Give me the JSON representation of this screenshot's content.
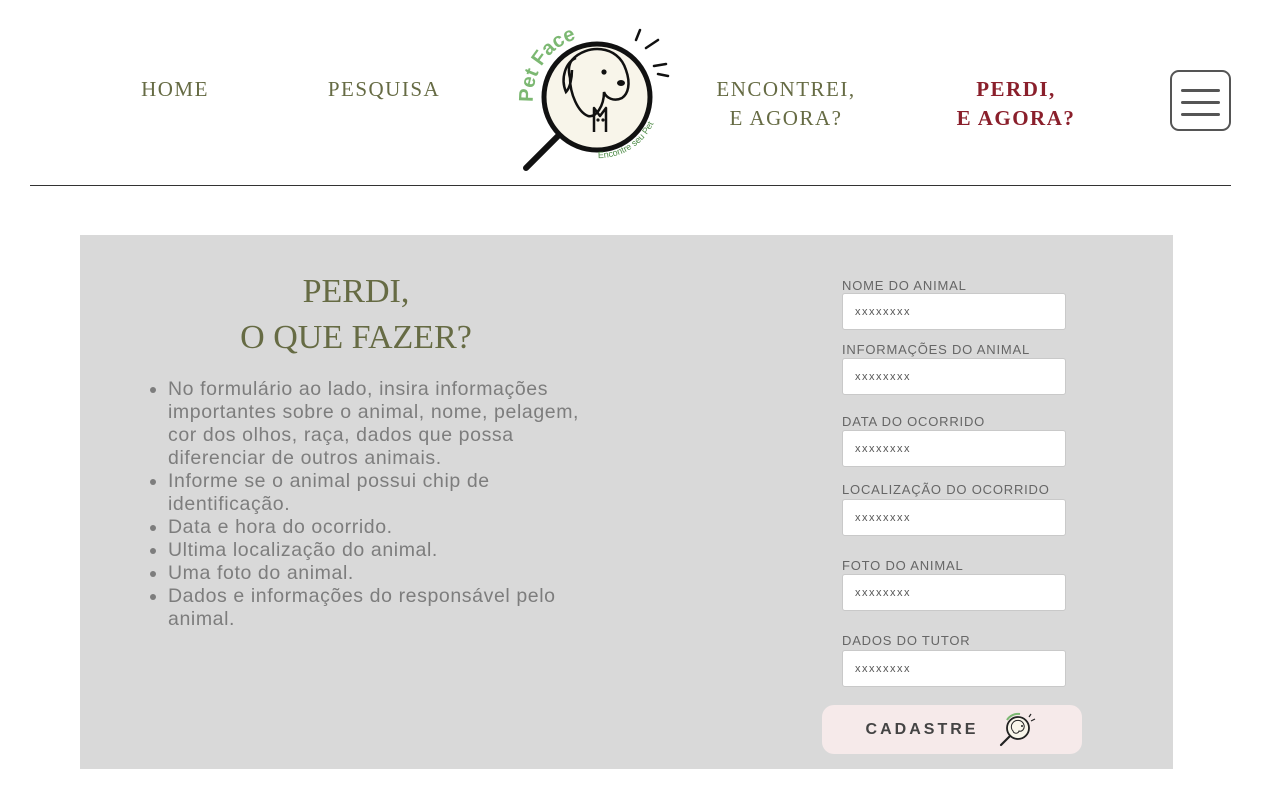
{
  "header": {
    "nav": {
      "home": "HOME",
      "pesquisa": "PESQUISA",
      "encontrei": [
        "ENCONTREI,",
        "E AGORA?"
      ],
      "perdi": [
        "PERDI,",
        "E AGORA?"
      ]
    },
    "logo": {
      "title": "Pet Face",
      "tagline": "Encontre seu Pet"
    },
    "menu_icon": "hamburger-menu-icon"
  },
  "main": {
    "title": [
      "PERDI,",
      "O QUE FAZER?"
    ],
    "instructions": [
      "No formulário ao lado, insira informações importantes sobre o animal,  nome, pelagem, cor dos olhos, raça, dados  que possa diferenciar de outros animais.",
      "Informe se o animal possui chip de identificação.",
      "Data e hora do ocorrido.",
      "Ultima localização do animal.",
      "Uma foto do animal.",
      "Dados e informações do responsável pelo animal."
    ],
    "form": {
      "fields": [
        {
          "label": "NOME DO ANIMAL",
          "placeholder": "xxxxxxxx"
        },
        {
          "label": "INFORMAÇÕES DO ANIMAL",
          "placeholder": "xxxxxxxx"
        },
        {
          "label": "DATA DO OCORRIDO",
          "placeholder": "xxxxxxxx"
        },
        {
          "label": "LOCALIZAÇÃO DO OCORRIDO",
          "placeholder": "xxxxxxxx"
        },
        {
          "label": "FOTO DO ANIMAL",
          "placeholder": "xxxxxxxx"
        },
        {
          "label": "DADOS DO TUTOR",
          "placeholder": "xxxxxxxx"
        }
      ],
      "submit_label": "CADASTRE",
      "submit_icon": "magnifier-pet-icon"
    }
  },
  "colors": {
    "nav_text": "#666b44",
    "nav_active": "#8a1f2b",
    "panel_bg": "#d9d9d9",
    "logo_green": "#7cb872",
    "button_bg": "#f6eaea"
  }
}
